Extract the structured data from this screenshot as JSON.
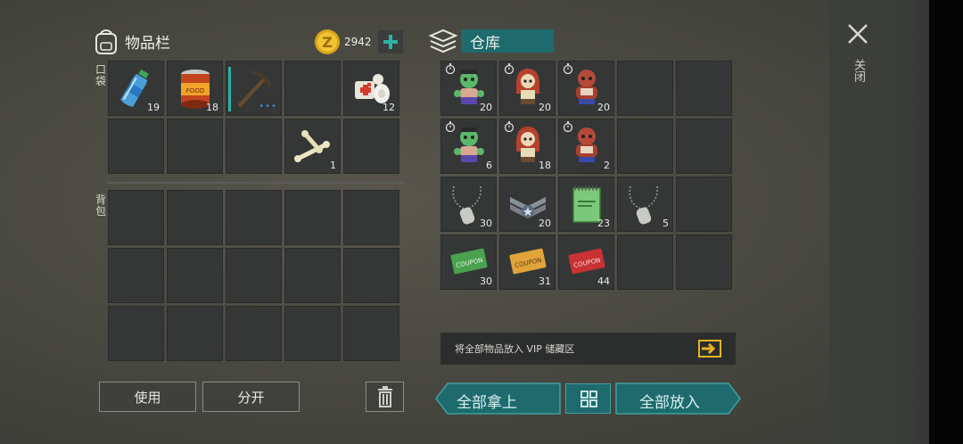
{
  "inventory": {
    "title": "物品栏",
    "currency": "2942",
    "pocket_label": "口袋",
    "backpack_label": "背包",
    "pocket_items": [
      {
        "icon": "water-bottle-icon",
        "qty": "19"
      },
      {
        "icon": "canned-food-icon",
        "qty": "18"
      },
      {
        "icon": "pickaxe-icon",
        "qty": ""
      },
      {
        "icon": "",
        "qty": ""
      },
      {
        "icon": "bandage-icon",
        "qty": "12"
      },
      {
        "icon": "",
        "qty": ""
      },
      {
        "icon": "",
        "qty": ""
      },
      {
        "icon": "",
        "qty": ""
      },
      {
        "icon": "bones-icon",
        "qty": "1"
      },
      {
        "icon": "",
        "qty": ""
      }
    ]
  },
  "storage": {
    "title": "仓库",
    "items": [
      {
        "icon": "green-zombie-doll-icon",
        "qty": "20",
        "timer": true
      },
      {
        "icon": "red-hair-doll-icon",
        "qty": "20",
        "timer": true
      },
      {
        "icon": "red-zombie-doll-icon",
        "qty": "20",
        "timer": true
      },
      {
        "icon": "",
        "qty": ""
      },
      {
        "icon": "",
        "qty": ""
      },
      {
        "icon": "green-zombie-doll-icon",
        "qty": "6",
        "timer": true
      },
      {
        "icon": "red-hair-doll-icon",
        "qty": "18",
        "timer": true
      },
      {
        "icon": "red-zombie-doll-icon",
        "qty": "2",
        "timer": true
      },
      {
        "icon": "",
        "qty": ""
      },
      {
        "icon": "",
        "qty": ""
      },
      {
        "icon": "dog-tag-icon",
        "qty": "30"
      },
      {
        "icon": "sergeant-badge-icon",
        "qty": "20"
      },
      {
        "icon": "notebook-icon",
        "qty": "23"
      },
      {
        "icon": "dog-tag-icon",
        "qty": "5"
      },
      {
        "icon": "",
        "qty": ""
      },
      {
        "icon": "green-coupon-icon",
        "qty": "30"
      },
      {
        "icon": "orange-coupon-icon",
        "qty": "31"
      },
      {
        "icon": "red-coupon-icon",
        "qty": "44"
      },
      {
        "icon": "",
        "qty": ""
      },
      {
        "icon": "",
        "qty": ""
      }
    ],
    "vip_text": "将全部物品放入 VIP 储藏区"
  },
  "actions": {
    "use": "使用",
    "split": "分开",
    "take_all": "全部拿上",
    "put_all": "全部放入"
  },
  "close_label": "关闭",
  "colors": {
    "teal": "#1e6a6c",
    "gold": "#e8b420",
    "accent_teal": "#2bb3a8"
  }
}
